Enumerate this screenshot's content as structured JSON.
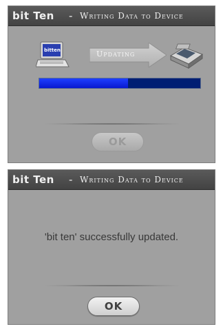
{
  "dialog_updating": {
    "title": {
      "brand": "bit Ten",
      "separator": "-",
      "text": "Writing Data to Device"
    },
    "arrow_label": "Updating",
    "laptop_label": "bitten",
    "progress": 0.55,
    "ok_label": "OK",
    "ok_enabled": false
  },
  "dialog_done": {
    "title": {
      "brand": "bit Ten",
      "separator": "-",
      "text": "Writing Data to Device"
    },
    "message": "'bit ten' successfully updated.",
    "ok_label": "OK",
    "ok_enabled": true
  },
  "colors": {
    "dialog_bg": "#a0a0a0",
    "titlebar_bg": "#4c4c4c",
    "progress_fill": "#1e3fff",
    "progress_track": "#001e73",
    "arrow": "#c4c4c4"
  },
  "icons": [
    "laptop-icon",
    "arrow-right-icon",
    "device-icon"
  ]
}
